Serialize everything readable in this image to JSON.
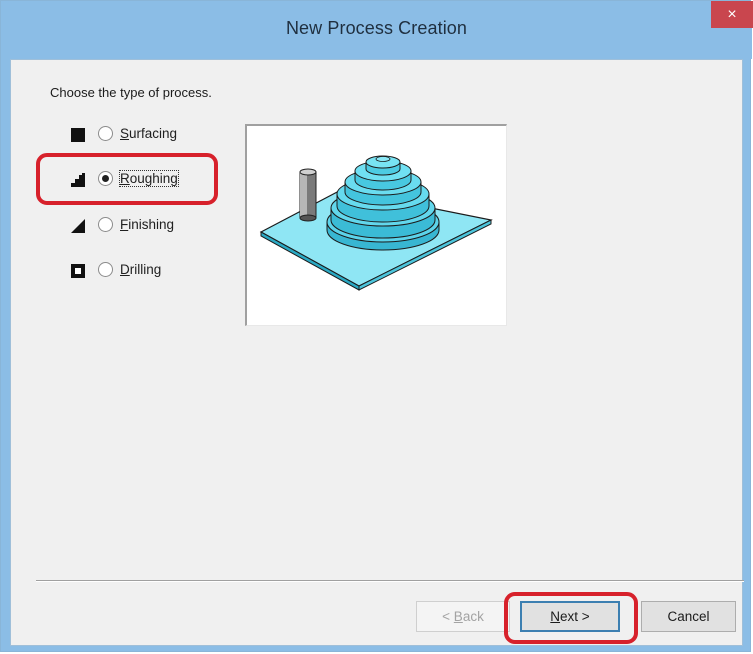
{
  "window": {
    "title": "New Process Creation",
    "close_glyph": "×"
  },
  "prompt": "Choose the type of process.",
  "options": [
    {
      "label_mnemonic": "S",
      "label_rest": "urfacing",
      "icon": "surfacing-icon",
      "selected": false
    },
    {
      "label_mnemonic": "R",
      "label_rest": "oughing",
      "icon": "roughing-icon",
      "selected": true
    },
    {
      "label_mnemonic": "F",
      "label_rest": "inishing",
      "icon": "finishing-icon",
      "selected": false
    },
    {
      "label_mnemonic": "D",
      "label_rest": "rilling",
      "icon": "drilling-icon",
      "selected": false
    }
  ],
  "buttons": {
    "back_prefix": "< ",
    "back_mnemonic": "B",
    "back_rest": "ack",
    "next_mnemonic": "N",
    "next_rest": "ext >",
    "cancel": "Cancel"
  },
  "colors": {
    "titlebar": "#8bbde6",
    "close_button": "#c9464e",
    "highlight": "#d7212b",
    "preview_cyan": "#55d0e8"
  }
}
